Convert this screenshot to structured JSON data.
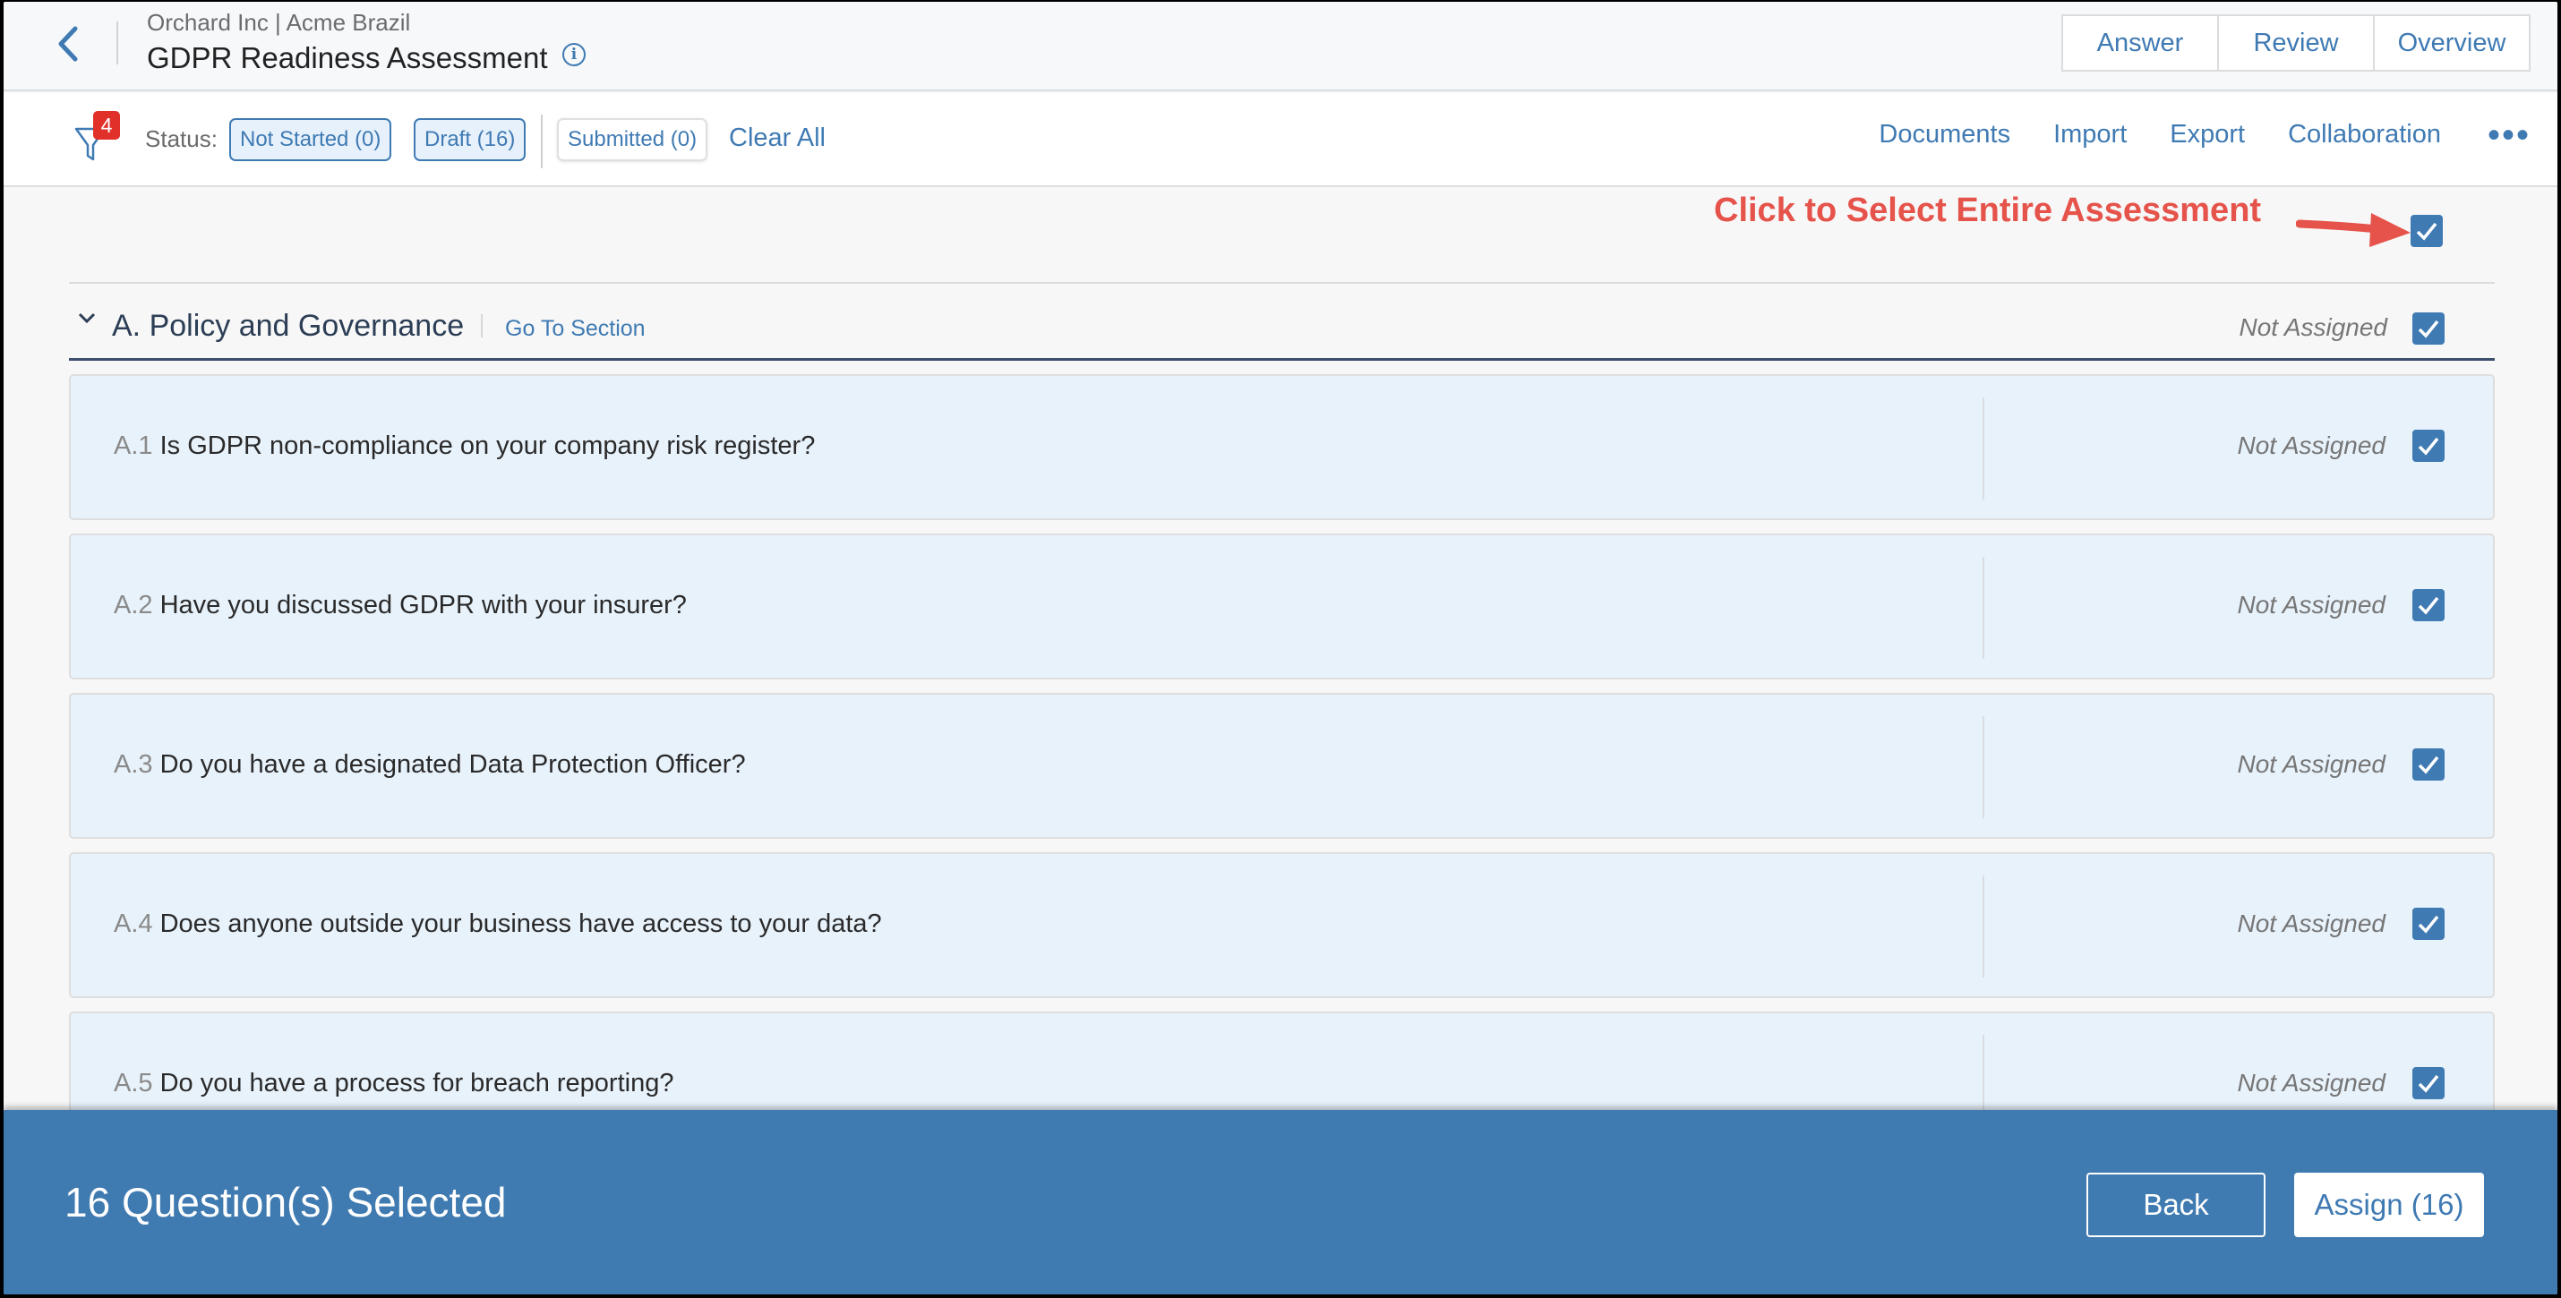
{
  "header": {
    "org": "Orchard Inc | Acme Brazil",
    "title": "GDPR Readiness Assessment",
    "view_tabs": [
      "Answer",
      "Review",
      "Overview"
    ]
  },
  "filterbar": {
    "filter_badge": "4",
    "status_label": "Status:",
    "chips": [
      {
        "label": "Not Started (0)",
        "active": true
      },
      {
        "label": "Draft (16)",
        "active": true
      },
      {
        "label": "Submitted (0)",
        "active": false
      }
    ],
    "clear_all": "Clear All",
    "actions": [
      "Documents",
      "Import",
      "Export",
      "Collaboration"
    ],
    "more_icon": "•••"
  },
  "annotation": {
    "text": "Click to Select Entire Assessment",
    "color": "#e5534b"
  },
  "section": {
    "title": "A. Policy and Governance",
    "go_to": "Go To Section",
    "assignee": "Not Assigned",
    "checked": true
  },
  "questions": [
    {
      "num": "A.1",
      "text": "Is GDPR non-compliance on your company risk register?",
      "assignee": "Not Assigned",
      "checked": true
    },
    {
      "num": "A.2",
      "text": "Have you discussed GDPR with your insurer?",
      "assignee": "Not Assigned",
      "checked": true
    },
    {
      "num": "A.3",
      "text": "Do you have a designated Data Protection Officer?",
      "assignee": "Not Assigned",
      "checked": true
    },
    {
      "num": "A.4",
      "text": "Does anyone outside your business have access to your data?",
      "assignee": "Not Assigned",
      "checked": true
    },
    {
      "num": "A.5",
      "text": "Do you have a process for breach reporting?",
      "assignee": "Not Assigned",
      "checked": true
    }
  ],
  "bottombar": {
    "selected_text": "16 Question(s) Selected",
    "back": "Back",
    "assign": "Assign (16)"
  },
  "colors": {
    "accent": "#3f7ab3",
    "bottombar": "#3f7ab0",
    "row_bg": "#e8f2fb",
    "badge": "#e1302a"
  }
}
